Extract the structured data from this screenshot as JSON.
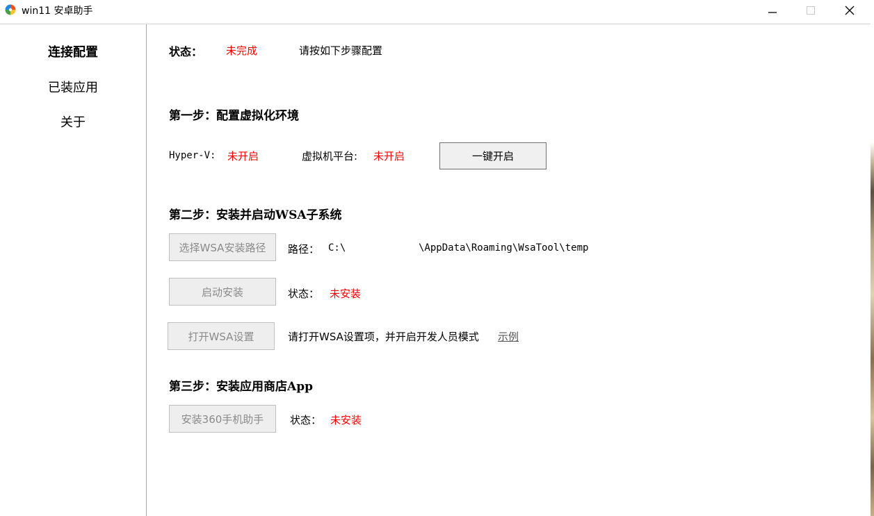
{
  "window": {
    "title": "win11 安卓助手",
    "controls": {
      "minimize": "—",
      "maximize": "□",
      "close": "✕"
    }
  },
  "sidebar": {
    "items": [
      {
        "label": "连接配置",
        "active": true
      },
      {
        "label": "已装应用",
        "active": false
      },
      {
        "label": "关于",
        "active": false
      }
    ]
  },
  "status": {
    "label": "状态：",
    "value": "未完成",
    "hint": "请按如下步骤配置"
  },
  "step1": {
    "title": "第一步：配置虚拟化环境",
    "hyperv_label": "Hyper-V:",
    "hyperv_value": "未开启",
    "vm_label": "虚拟机平台:",
    "vm_value": "未开启",
    "enable_button": "一键开启"
  },
  "step2": {
    "title": "第二步：安装并启动WSA子系统",
    "select_path_button": "选择WSA安装路径",
    "path_label": "路径：",
    "path_prefix": "C:\\",
    "path_suffix": "\\AppData\\Roaming\\WsaTool\\temp",
    "start_install_button": "启动安装",
    "install_status_label": "状态：",
    "install_status_value": "未安装",
    "open_settings_button": "打开WSA设置",
    "settings_hint": "请打开WSA设置项，并开启开发人员模式",
    "example_link": "示例"
  },
  "step3": {
    "title": "第三步：安装应用商店App",
    "install_button": "安装360手机助手",
    "status_label": "状态：",
    "status_value": "未安装"
  },
  "colors": {
    "error": "#ff0000",
    "divider": "#a8a8a8",
    "button_bg": "#f0f0f0",
    "disabled_text": "#8a8a8a"
  },
  "icons": {
    "app": "colorful-pinwheel-icon",
    "minimize": "minimize-icon",
    "maximize": "maximize-icon",
    "close": "close-icon"
  }
}
